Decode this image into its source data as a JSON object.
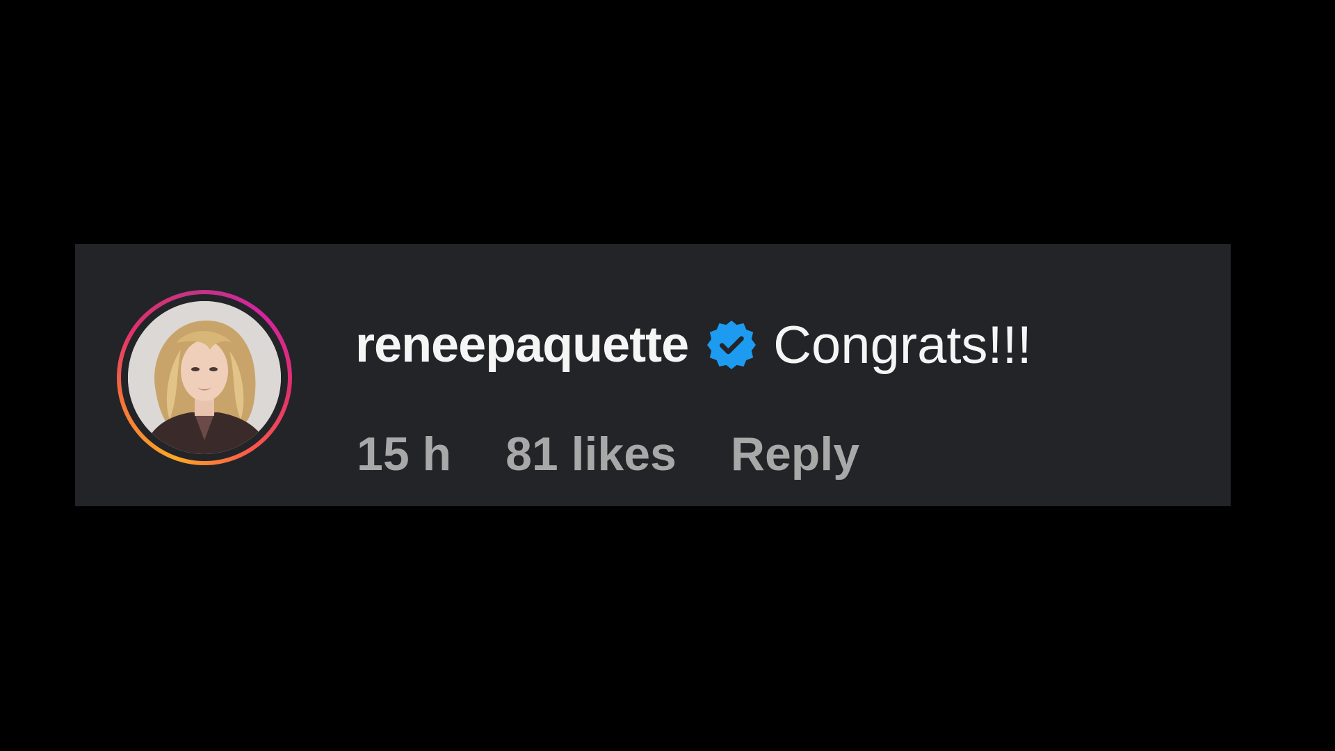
{
  "comment": {
    "username": "reneepaquette",
    "verified": true,
    "text": "Congrats!!!",
    "timestamp": "15 h",
    "likes": "81 likes",
    "reply_label": "Reply"
  },
  "colors": {
    "background": "#000000",
    "card": "#232428",
    "primary_text": "#f5f5f5",
    "secondary_text": "#a8a8a8",
    "verified_badge": "#1d9bf0",
    "story_ring": [
      "#f9a826",
      "#e1306c",
      "#c13584"
    ]
  },
  "icons": {
    "verified": "verified-badge-icon"
  }
}
